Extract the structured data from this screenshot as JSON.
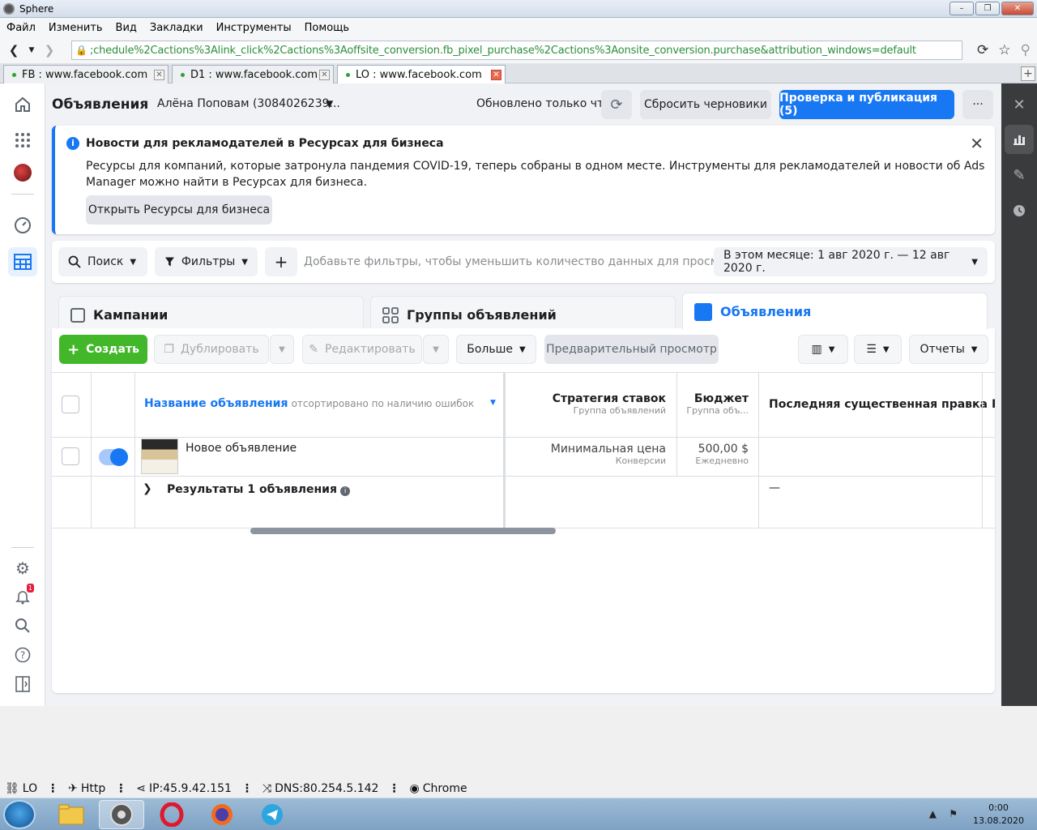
{
  "window": {
    "title": "Sphere",
    "controls": [
      "–",
      "❐",
      "✕"
    ]
  },
  "menu": [
    "Файл",
    "Изменить",
    "Вид",
    "Закладки",
    "Инструменты",
    "Помощь"
  ],
  "address": {
    "url": ";chedule%2Cactions%3Alink_click%2Cactions%3Aoffsite_conversion.fb_pixel_purchase%2Cactions%3Aonsite_conversion.purchase&attribution_windows=default"
  },
  "tabs": [
    {
      "label": "FB : www.facebook.com",
      "active": false
    },
    {
      "label": "D1 : www.facebook.com",
      "active": false
    },
    {
      "label": "LO : www.facebook.com",
      "active": true
    }
  ],
  "header": {
    "title": "Объявления",
    "account": "Алёна Поповам (3084026239...",
    "updated": "Обновлено только что",
    "reset_drafts": "Сбросить черновики",
    "publish": "Проверка и публикация (5)",
    "more": "···"
  },
  "banner": {
    "title": "Новости для рекламодателей в Ресурсах для бизнеса",
    "text": "Ресурсы для компаний, которые затронула пандемия COVID-19, теперь собраны в одном месте. Инструменты для рекламодателей и новости об Ads Manager можно найти в Ресурсах для бизнеса.",
    "button": "Открыть Ресурсы для бизнеса"
  },
  "filters": {
    "search": "Поиск",
    "filters": "Фильтры",
    "add": "+",
    "hint": "Добавьте фильтры, чтобы уменьшить количество данных для просмотра.",
    "date_range": "В этом месяце: 1 авг 2020 г. — 12 авг 2020 г."
  },
  "level_tabs": [
    "Кампании",
    "Группы объявлений",
    "Объявления"
  ],
  "toolbar": {
    "create": "Создать",
    "duplicate": "Дублировать",
    "edit": "Редактировать",
    "more": "Больше",
    "preview": "Предварительный просмотр",
    "reports": "Отчеты"
  },
  "table": {
    "columns": {
      "name": "Название объявления",
      "name_sort": "отсортировано по наличию ошибок",
      "bid": "Стратегия ставок",
      "bid_sub": "Группа объявлений",
      "budget": "Бюджет",
      "budget_sub": "Группа объ...",
      "last_edit": "Последняя существенная правка",
      "next": "Р"
    },
    "rows": [
      {
        "name": "Новое объявление",
        "bid": "Минимальная цена",
        "bid_sub": "Конверсии",
        "budget": "500,00 $",
        "budget_sub": "Ежедневно"
      }
    ],
    "summary": {
      "label": "Результаты 1 объявления",
      "last_edit": "—"
    }
  },
  "left_nav": {
    "icons": [
      "home-icon",
      "apps-grid-icon",
      "avatar",
      "dashboard-gauge-icon",
      "ads-manager-table-icon",
      "settings-gear-icon",
      "notifications-bell-icon",
      "search-icon",
      "help-icon",
      "side-panel-icon"
    ],
    "notification_count": "1"
  },
  "statusbar": {
    "profile": "LO",
    "protocol": "Http",
    "ip": "IP:45.9.42.151",
    "dns": "DNS:80.254.5.142",
    "browser": "Chrome"
  },
  "taskbar": {
    "time": "0:00",
    "date": "13.08.2020"
  },
  "colors": {
    "accent": "#1877f2",
    "create_green": "#42b72a",
    "url_green": "#2a8f3a"
  }
}
